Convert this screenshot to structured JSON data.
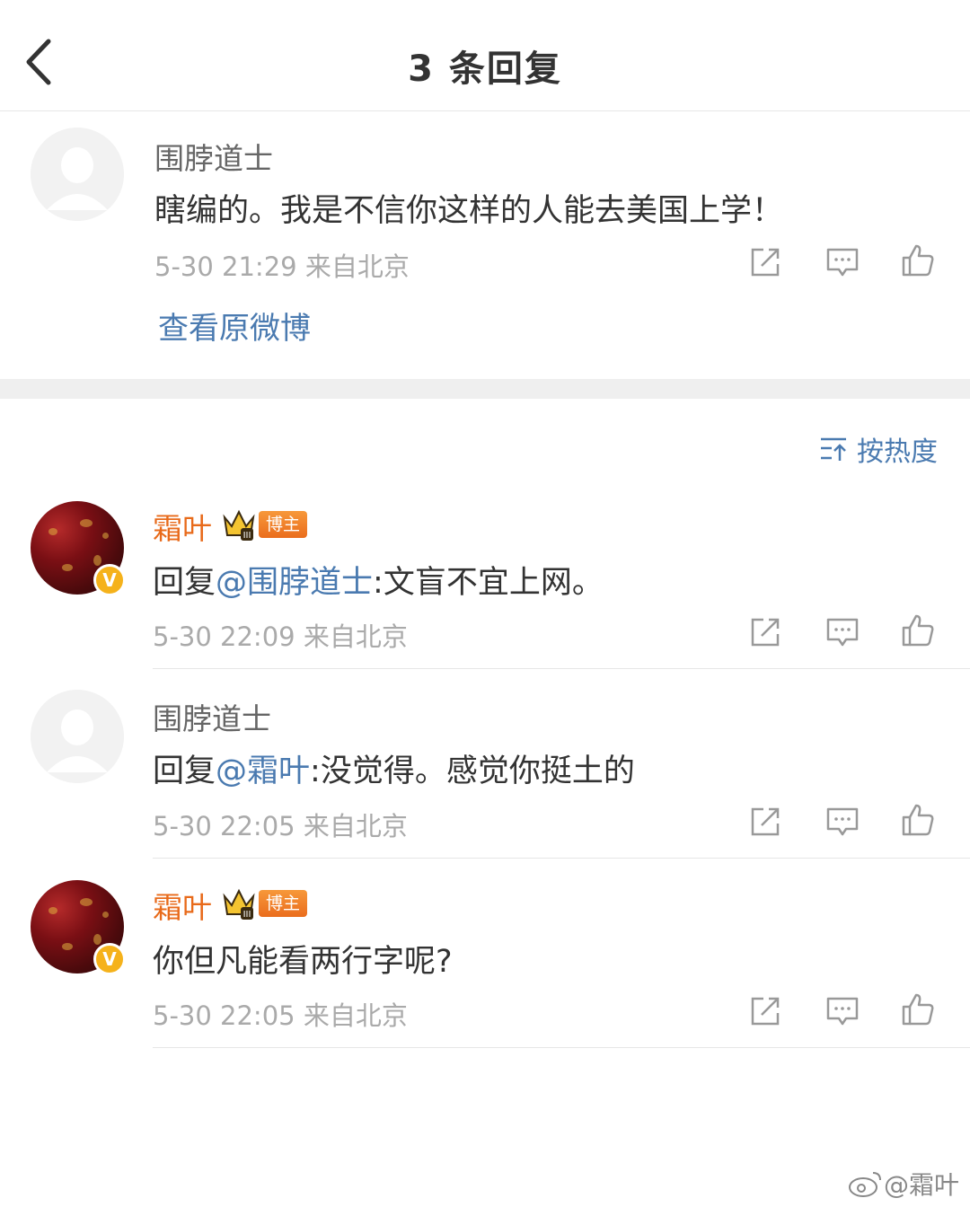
{
  "header": {
    "title": "3 条回复",
    "back_icon": "chevron-left-icon"
  },
  "original_comment": {
    "username": "围脖道士",
    "text": "瞎编的。我是不信你这样的人能去美国上学！",
    "meta": "5-30 21:29  来自北京",
    "view_original_label": "查看原微博"
  },
  "sort": {
    "label": "按热度",
    "icon": "sort-icon"
  },
  "replies": [
    {
      "username": "霜叶",
      "badge": "博主",
      "prefix": "回复",
      "mention": "@围脖道士",
      "text": ":文盲不宜上网。",
      "meta": "5-30 22:09  来自北京"
    },
    {
      "username": "围脖道士",
      "prefix": "回复",
      "mention": "@霜叶",
      "text": ":没觉得。感觉你挺土的",
      "meta": "5-30 22:05  来自北京"
    },
    {
      "username": "霜叶",
      "badge": "博主",
      "text": "你但凡能看两行字呢?",
      "meta": "5-30 22:05  来自北京"
    }
  ],
  "watermark": "@霜叶",
  "colors": {
    "link": "#4a7ab0",
    "vip_name": "#e86a1a",
    "meta": "#aaaaaa"
  }
}
